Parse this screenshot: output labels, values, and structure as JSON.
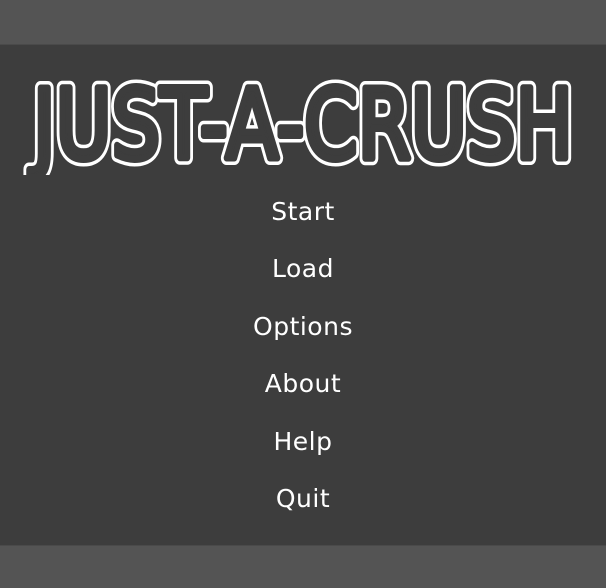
{
  "game": {
    "title": "JUST-A-CRUSH"
  },
  "menu": {
    "items": [
      {
        "label": "Start"
      },
      {
        "label": "Load"
      },
      {
        "label": "Options"
      },
      {
        "label": "About"
      },
      {
        "label": "Help"
      },
      {
        "label": "Quit"
      }
    ]
  },
  "colors": {
    "background": "#545454",
    "panel": "#3d3d3d",
    "text": "#ffffff"
  }
}
